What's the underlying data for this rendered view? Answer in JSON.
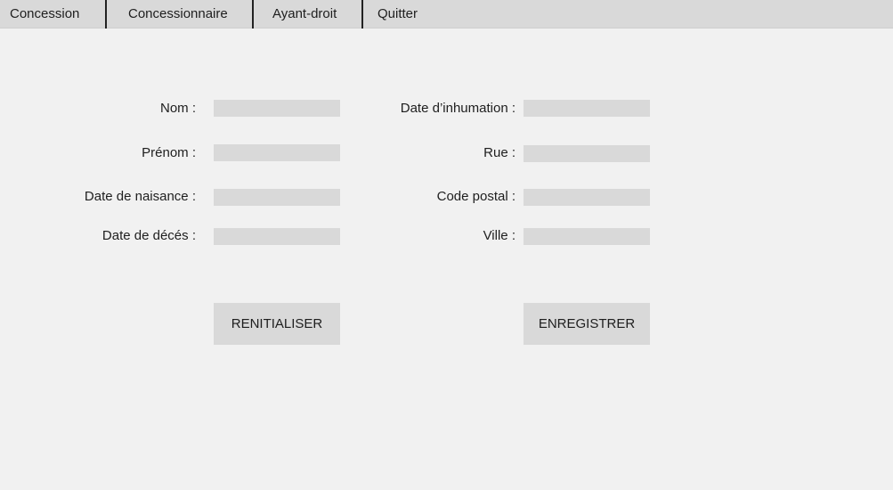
{
  "menu": {
    "items": [
      {
        "label": "Concession"
      },
      {
        "label": "Concessionnaire"
      },
      {
        "label": "Ayant-droit"
      },
      {
        "label": "Quitter"
      }
    ]
  },
  "form": {
    "left": {
      "nom_label": "Nom :",
      "prenom_label": "Prénom :",
      "naissance_label": "Date de naisance :",
      "deces_label": "Date de décés :"
    },
    "right": {
      "inhumation_label": "Date d’inhumation :",
      "rue_label": "Rue :",
      "code_postal_label": "Code postal :",
      "ville_label": "Ville :"
    },
    "fields": {
      "nom": "",
      "prenom": "",
      "naissance": "",
      "deces": "",
      "inhumation": "",
      "rue": "",
      "code_postal": "",
      "ville": ""
    }
  },
  "buttons": {
    "reset_label": "RENITIALISER",
    "save_label": "ENREGISTRER"
  },
  "colors": {
    "background": "#f1f1f1",
    "menubar": "#d9d9d9",
    "field": "#d9d9d9",
    "text": "#1e1e1e"
  }
}
